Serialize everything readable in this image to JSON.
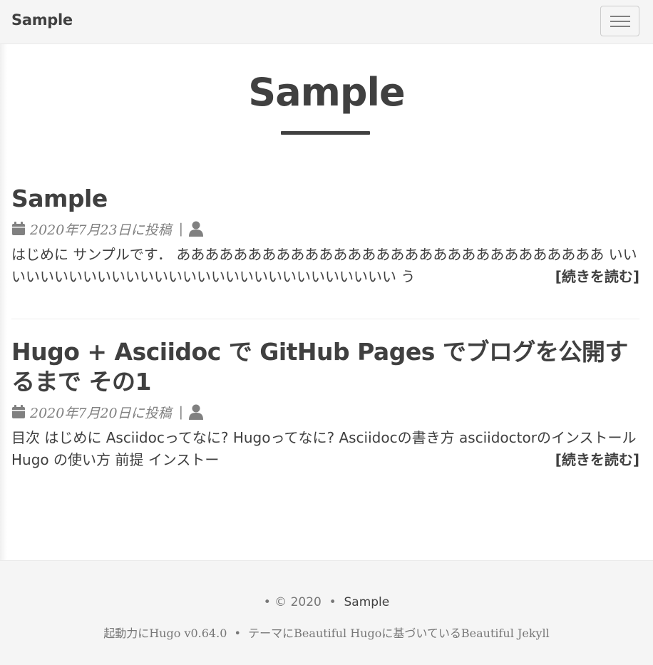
{
  "navbar": {
    "brand": "Sample",
    "menu_icon": "hamburger-icon"
  },
  "hero": {
    "title": "Sample"
  },
  "posts": [
    {
      "title": "Sample",
      "date": "2020年7月23日に投稿",
      "separator": "|",
      "date_icon": "calendar-icon",
      "author_icon": "user-icon",
      "preview": "はじめに サンプルです． ああああああああああああああああああああああああああああああ いいいいいいいいいいいいいいいいいいいいいいいいいいいいい う",
      "read_more": "[続きを読む]"
    },
    {
      "title": "Hugo + Asciidoc で GitHub Pages でブログを公開するまで その1",
      "date": "2020年7月20日に投稿",
      "separator": "|",
      "date_icon": "calendar-icon",
      "author_icon": "user-icon",
      "preview": "目次 はじめに Asciidocってなに? Hugoってなに? Asciidocの書き方 asciidoctorのインストール Hugo の使い方 前提 インストー",
      "read_more": "[続きを読む]"
    }
  ],
  "footer": {
    "bullet": "•",
    "copyright": "© 2020",
    "site_name": "Sample",
    "powered_prefix": "起動力に",
    "hugo_version": "Hugo v0.64.0",
    "theme_prefix": "テーマに",
    "theme_name": "Beautiful Hugo",
    "theme_suffix": "に基づいている",
    "jekyll": "Beautiful Jekyll"
  },
  "colors": {
    "text": "#404040",
    "muted": "#808080",
    "navbar_bg": "#f5f5f5",
    "footer_bg": "#f5f5f5"
  }
}
